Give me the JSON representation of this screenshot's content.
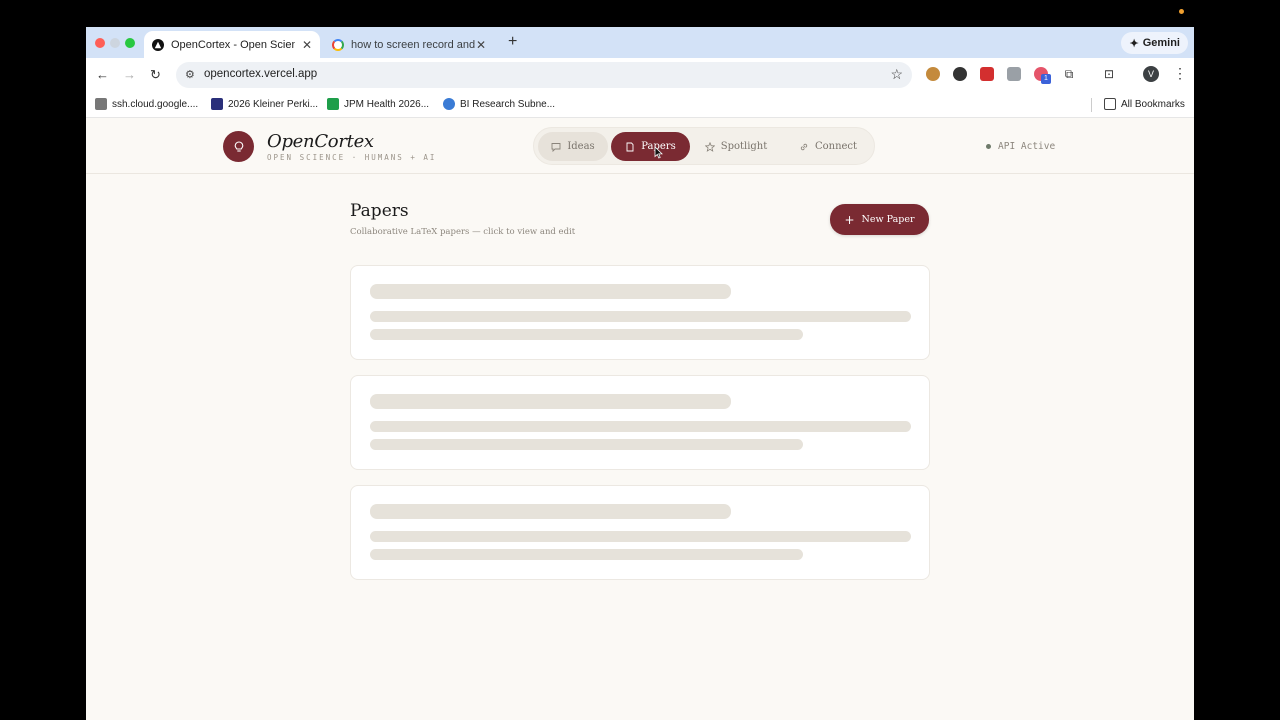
{
  "browser": {
    "tabs": [
      {
        "title": "OpenCortex - Open Science",
        "active": true
      },
      {
        "title": "how to screen record and au",
        "active": false
      }
    ],
    "gemini_label": "Gemini",
    "url": "opencortex.vercel.app",
    "bookmarks": [
      {
        "label": "ssh.cloud.google....",
        "icon": "monitor-icon"
      },
      {
        "label": "2026 Kleiner Perki...",
        "icon": "a-logo-icon"
      },
      {
        "label": "JPM Health 2026...",
        "icon": "sheets-icon"
      },
      {
        "label": "BI Research Subne...",
        "icon": "globe-icon"
      }
    ],
    "all_bookmarks_label": "All Bookmarks",
    "profile_initial": "V",
    "extension_badge": "1"
  },
  "app": {
    "brand": "OpenCortex",
    "tagline": "OPEN SCIENCE · HUMANS + AI",
    "nav": [
      {
        "label": "Ideas",
        "icon": "chat-icon",
        "active": false
      },
      {
        "label": "Papers",
        "icon": "document-icon",
        "active": true
      },
      {
        "label": "Spotlight",
        "icon": "star-icon",
        "active": false
      },
      {
        "label": "Connect",
        "icon": "link-icon",
        "active": false
      }
    ],
    "api_status": "API Active",
    "page": {
      "title": "Papers",
      "subtitle": "Collaborative LaTeX papers — click to view and edit",
      "new_button_label": "New Paper"
    }
  },
  "colors": {
    "accent": "#7a2a32",
    "page_bg": "#fbf9f5",
    "skeleton": "#e6e2da",
    "tabstrip": "#d3e2f7"
  }
}
